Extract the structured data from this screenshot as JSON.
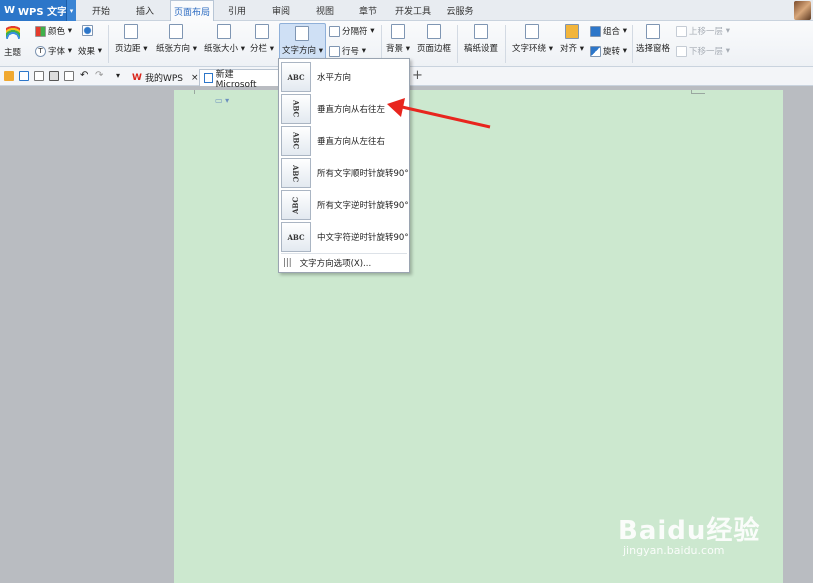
{
  "app": {
    "title": "WPS 文字"
  },
  "tabs": [
    "开始",
    "插入",
    "页面布局",
    "引用",
    "审阅",
    "视图",
    "章节",
    "开发工具",
    "云服务"
  ],
  "ribbon": {
    "theme": "主题",
    "color": "颜色",
    "font": "字体",
    "effect": "效果",
    "margins": "页边距",
    "orientation": "纸张方向",
    "size": "纸张大小",
    "columns": "分栏",
    "text_direction": "文字方向",
    "breaks": "分隔符",
    "line_numbers": "行号",
    "background": "背景",
    "page_border": "页面边框",
    "draft_settings": "稿纸设置",
    "wrap_text": "文字环绕",
    "align": "对齐",
    "group": "组合",
    "rotate": "旋转",
    "selection_pane": "选择窗格",
    "bring_forward": "上移一层",
    "send_backward": "下移一层"
  },
  "doc_tabs": {
    "home": "我的WPS",
    "current": "新建 Microsoft"
  },
  "dropdown": {
    "items": [
      {
        "label": "水平方向",
        "icon": "text-horizontal-icon"
      },
      {
        "label": "垂直方向从右往左",
        "icon": "text-vertical-rtl-icon"
      },
      {
        "label": "垂直方向从左往右",
        "icon": "text-vertical-ltr-icon"
      },
      {
        "label": "所有文字顺时针旋转90°",
        "icon": "text-rotate-cw-icon"
      },
      {
        "label": "所有文字逆时针旋转90°",
        "icon": "text-rotate-ccw-icon"
      },
      {
        "label": "中文字符逆时针旋转90°",
        "icon": "cjk-rotate-ccw-icon"
      }
    ],
    "options": "文字方向选项(X)..."
  },
  "watermark": {
    "brand": "Baidu经验",
    "url": "jingyan.baidu.com"
  },
  "colors": {
    "accent": "#2c76c9",
    "page": "#cce8cf",
    "arrow": "#e8251e"
  }
}
